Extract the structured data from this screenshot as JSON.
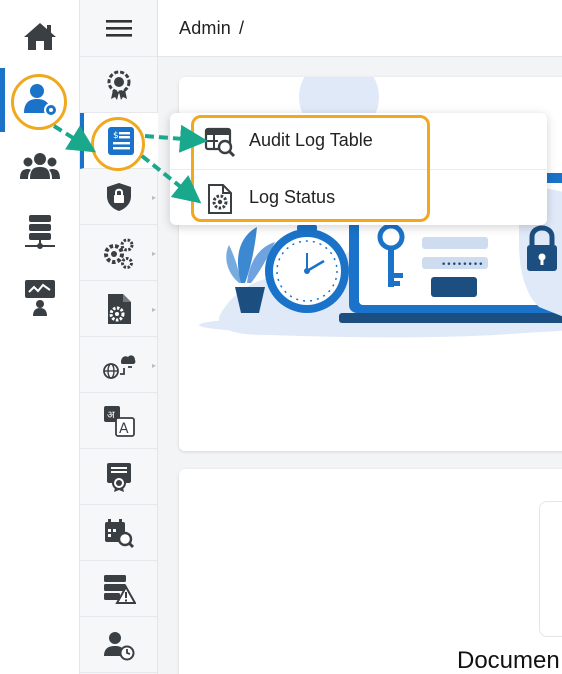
{
  "breadcrumb": {
    "section": "Admin",
    "separator": "/"
  },
  "rail": {
    "items": [
      "home-icon",
      "admin-user-icon",
      "users-group-icon",
      "database-icon",
      "presentation-user-icon"
    ]
  },
  "subnav": {
    "items": [
      "settings-badge-icon",
      "audit-log-icon",
      "shield-lock-icon",
      "gears-icon",
      "file-gear-icon",
      "globe-cloud-icon",
      "translate-icon",
      "certificate-icon",
      "calendar-search-icon",
      "server-warning-icon",
      "user-history-icon"
    ]
  },
  "popup": {
    "items": [
      {
        "label": "Audit Log Table",
        "icon": "table-search-icon"
      },
      {
        "label": "Log Status",
        "icon": "file-gear-icon"
      }
    ]
  },
  "content": {
    "card_title": "Documen"
  },
  "colors": {
    "accent": "#1a73c9",
    "highlight": "#f0a81f",
    "arrow": "#1aa88c",
    "icon": "#3a3f44"
  }
}
